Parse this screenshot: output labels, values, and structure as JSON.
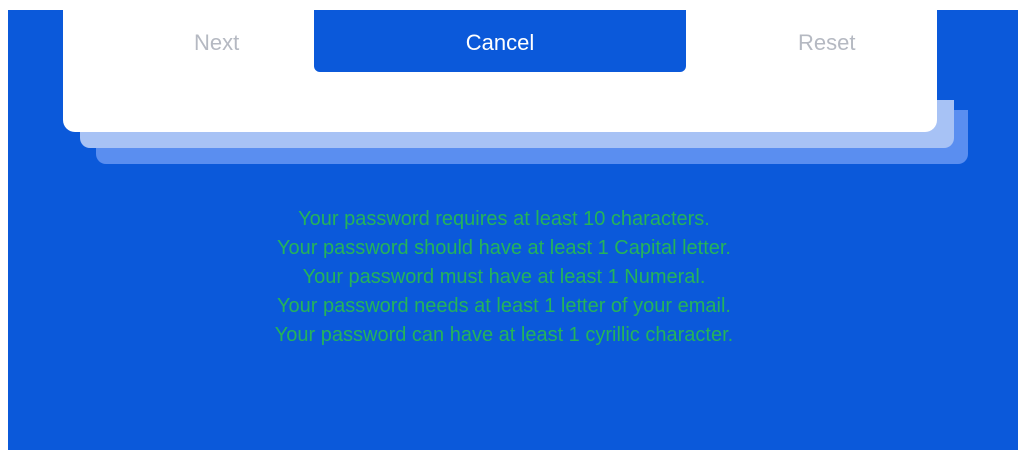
{
  "buttons": {
    "next_label": "Next",
    "cancel_label": "Cancel",
    "reset_label": "Reset"
  },
  "password_requirements": [
    "Your password requires at least 10 characters.",
    "Your password should have at least 1 Capital letter.",
    "Your password must have at least 1 Numeral.",
    "Your password needs at least 1 letter of your email.",
    "Your password can have at least 1 cyrillic character."
  ],
  "colors": {
    "background_blue": "#0b59da",
    "requirement_green": "#25b35a",
    "muted_button_text": "#b5b9c2",
    "card_white": "#ffffff"
  }
}
